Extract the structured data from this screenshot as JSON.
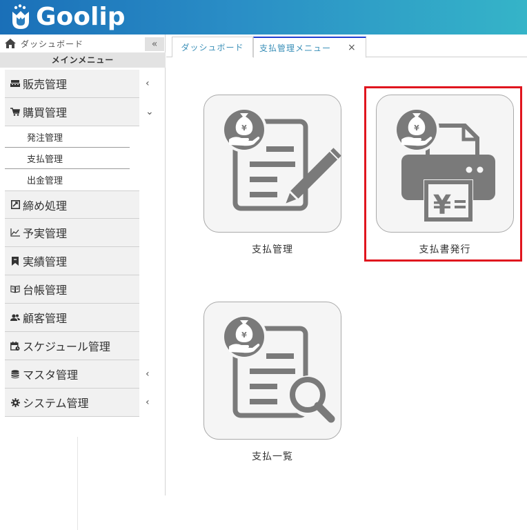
{
  "header": {
    "logo_text": "Goolip"
  },
  "sidebar": {
    "dashboard_label": "ダッシュボード",
    "collapse_label": "«",
    "main_menu_title": "メインメニュー",
    "items": [
      {
        "label": "販売管理",
        "icon": "register-icon",
        "chevron": "‹"
      },
      {
        "label": "購買管理",
        "icon": "cart-icon",
        "chevron": "⌄"
      },
      {
        "label": "締め処理",
        "icon": "checkbox-icon",
        "chevron": ""
      },
      {
        "label": "予実管理",
        "icon": "line-chart-icon",
        "chevron": ""
      },
      {
        "label": "実績管理",
        "icon": "bookmark-icon",
        "chevron": ""
      },
      {
        "label": "台帳管理",
        "icon": "book-icon",
        "chevron": ""
      },
      {
        "label": "顧客管理",
        "icon": "users-icon",
        "chevron": ""
      },
      {
        "label": "スケジュール管理",
        "icon": "calendar-icon",
        "chevron": ""
      },
      {
        "label": "マスタ管理",
        "icon": "database-icon",
        "chevron": "‹"
      },
      {
        "label": "システム管理",
        "icon": "gear-icon",
        "chevron": "‹"
      }
    ],
    "purchase_sub": [
      "発注管理",
      "支払管理",
      "出金管理"
    ]
  },
  "tabs": [
    {
      "label": "ダッシュボード"
    },
    {
      "label": "支払管理メニュー",
      "close": "×"
    }
  ],
  "tiles": [
    {
      "label": "支払管理",
      "icon": "payment-edit-icon"
    },
    {
      "label": "支払書発行",
      "icon": "payment-print-icon"
    },
    {
      "label": "支払一覧",
      "icon": "payment-search-icon"
    }
  ],
  "colors": {
    "header_start": "#1a6fb8",
    "header_end": "#35b4c8",
    "icon_gray": "#7a7a7a",
    "highlight": "#e0151e",
    "tab_accent": "#1f3fd1"
  }
}
